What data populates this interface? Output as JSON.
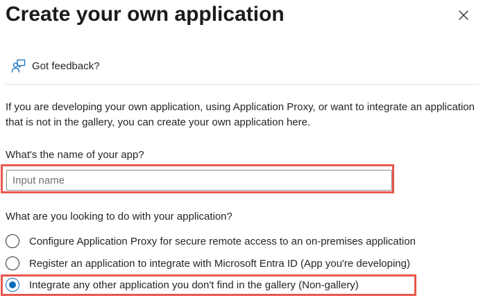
{
  "dialog": {
    "title": "Create your own application",
    "feedback_label": "Got feedback?",
    "intro_text": "If you are developing your own application, using Application Proxy, or want to integrate an application that is not in the gallery, you can create your own application here."
  },
  "name_field": {
    "label": "What's the name of your app?",
    "placeholder": "Input name",
    "value": ""
  },
  "purpose": {
    "question": "What are you looking to do with your application?",
    "selected_index": 2,
    "options": [
      {
        "label": "Configure Application Proxy for secure remote access to an on-premises application",
        "selected": false
      },
      {
        "label": "Register an application to integrate with Microsoft Entra ID (App you're developing)",
        "selected": false
      },
      {
        "label": "Integrate any other application you don't find in the gallery (Non-gallery)",
        "selected": true
      }
    ]
  },
  "icons": {
    "close": "close-icon",
    "feedback": "feedback-person-icon"
  },
  "colors": {
    "accent": "#0f6cbd",
    "highlight": "#e8574d",
    "text": "#242424",
    "divider": "#e1dfdd"
  }
}
